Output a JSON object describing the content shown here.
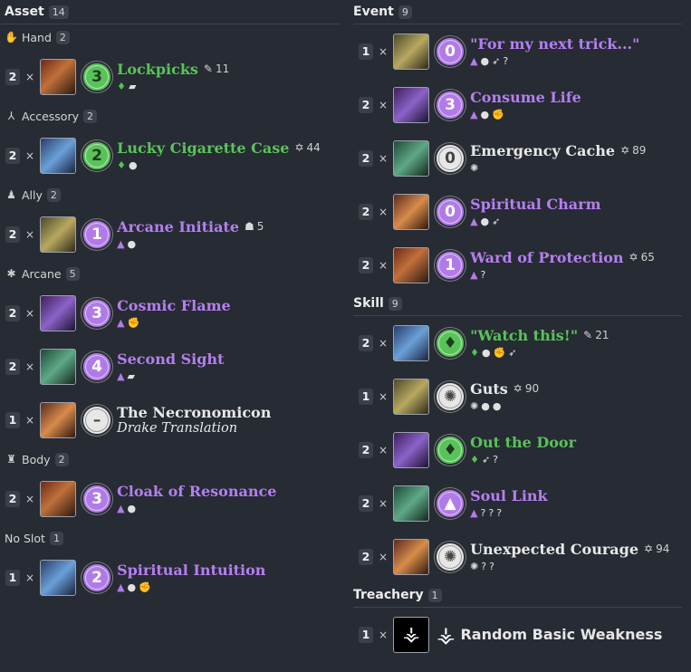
{
  "left": {
    "section": {
      "title": "Asset",
      "count": "14"
    },
    "groups": [
      {
        "slot": "Hand",
        "count": "2",
        "icon": "hand-icon",
        "glyph": "✋",
        "cards": [
          {
            "qty": "2",
            "x": "×",
            "name": "Lockpicks",
            "cost": "3",
            "cls": "seeker",
            "xp": "11",
            "xp_icon": "brain-icon",
            "icons": [
              "seeker-icon",
              "book-icon"
            ]
          }
        ]
      },
      {
        "slot": "Accessory",
        "count": "2",
        "icon": "accessory-icon",
        "glyph": "⅄",
        "cards": [
          {
            "qty": "2",
            "x": "×",
            "name": "Lucky Cigarette Case",
            "cost": "2",
            "cls": "seeker",
            "xp": "44",
            "xp_icon": "elder-sign-icon",
            "icons": [
              "seeker-icon",
              "willpower-icon"
            ]
          }
        ]
      },
      {
        "slot": "Ally",
        "count": "2",
        "icon": "ally-icon",
        "glyph": "♟",
        "cards": [
          {
            "qty": "2",
            "x": "×",
            "name": "Arcane Initiate",
            "cost": "1",
            "cls": "mystic",
            "xp": "5",
            "xp_icon": "cultist-icon",
            "icons": [
              "mystic-icon",
              "willpower-icon"
            ]
          }
        ]
      },
      {
        "slot": "Arcane",
        "count": "5",
        "icon": "arcane-icon",
        "glyph": "✱",
        "cards": [
          {
            "qty": "2",
            "x": "×",
            "name": "Cosmic Flame",
            "cost": "3",
            "cls": "mystic",
            "icons": [
              "mystic-icon",
              "combat-icon"
            ]
          },
          {
            "qty": "2",
            "x": "×",
            "name": "Second Sight",
            "cost": "4",
            "cls": "mystic",
            "icons": [
              "mystic-icon",
              "book-icon"
            ]
          },
          {
            "qty": "1",
            "x": "×",
            "name": "The Necronomicon",
            "subtitle": "Drake Translation",
            "cost": "–",
            "cls": "neutral",
            "icons": []
          }
        ]
      },
      {
        "slot": "Body",
        "count": "2",
        "icon": "body-icon",
        "glyph": "♜",
        "cards": [
          {
            "qty": "2",
            "x": "×",
            "name": "Cloak of Resonance",
            "cost": "3",
            "cls": "mystic",
            "icons": [
              "mystic-icon",
              "willpower-icon"
            ]
          }
        ]
      },
      {
        "slot": "No Slot",
        "count": "1",
        "icon": "",
        "glyph": "",
        "cards": [
          {
            "qty": "1",
            "x": "×",
            "name": "Spiritual Intuition",
            "cost": "2",
            "cls": "mystic",
            "icons": [
              "mystic-icon",
              "willpower-icon",
              "combat-icon"
            ]
          }
        ]
      }
    ]
  },
  "right": {
    "event": {
      "title": "Event",
      "count": "9",
      "cards": [
        {
          "qty": "1",
          "x": "×",
          "name": "\"For my next trick...\"",
          "cost": "0",
          "cls": "mystic",
          "icons": [
            "mystic-icon",
            "willpower-icon",
            "agility-icon",
            "wild-icon"
          ]
        },
        {
          "qty": "2",
          "x": "×",
          "name": "Consume Life",
          "cost": "3",
          "cls": "mystic",
          "icons": [
            "mystic-icon",
            "willpower-icon",
            "combat-icon"
          ]
        },
        {
          "qty": "2",
          "x": "×",
          "name": "Emergency Cache",
          "cost": "0",
          "cls": "neutral",
          "xp": "89",
          "xp_icon": "elder-sign-icon",
          "icons": [
            "neutral-icon"
          ]
        },
        {
          "qty": "2",
          "x": "×",
          "name": "Spiritual Charm",
          "cost": "0",
          "cls": "mystic",
          "icons": [
            "mystic-icon",
            "willpower-icon",
            "agility-icon"
          ]
        },
        {
          "qty": "2",
          "x": "×",
          "name": "Ward of Protection",
          "cost": "1",
          "cls": "mystic",
          "xp": "65",
          "xp_icon": "elder-sign-icon",
          "icons": [
            "mystic-icon",
            "wild-icon"
          ]
        }
      ]
    },
    "skill": {
      "title": "Skill",
      "count": "9",
      "cards": [
        {
          "qty": "2",
          "x": "×",
          "name": "\"Watch this!\"",
          "cost": "",
          "cls": "seeker",
          "xp": "21",
          "xp_icon": "brain-icon",
          "icons": [
            "seeker-icon",
            "willpower-icon",
            "combat-icon",
            "agility-icon"
          ]
        },
        {
          "qty": "1",
          "x": "×",
          "name": "Guts",
          "cost": "",
          "cls": "neutral",
          "xp": "90",
          "xp_icon": "elder-sign-icon",
          "icons": [
            "neutral-icon",
            "willpower-icon",
            "willpower-icon"
          ]
        },
        {
          "qty": "2",
          "x": "×",
          "name": "Out the Door",
          "cost": "",
          "cls": "seeker",
          "icons": [
            "seeker-icon",
            "agility-icon",
            "wild-icon"
          ]
        },
        {
          "qty": "2",
          "x": "×",
          "name": "Soul Link",
          "cost": "",
          "cls": "mystic",
          "icons": [
            "mystic-icon",
            "wild-icon",
            "wild-icon",
            "wild-icon"
          ]
        },
        {
          "qty": "2",
          "x": "×",
          "name": "Unexpected Courage",
          "cost": "",
          "cls": "neutral",
          "xp": "94",
          "xp_icon": "elder-sign-icon",
          "icons": [
            "neutral-icon",
            "wild-icon",
            "wild-icon"
          ]
        }
      ]
    },
    "treachery": {
      "title": "Treachery",
      "count": "1",
      "cards": [
        {
          "qty": "1",
          "x": "×",
          "name": "Random Basic Weakness"
        }
      ]
    }
  },
  "colors": {
    "seeker": "#59c35a",
    "mystic": "#b47ff0",
    "neutral": "#e8e8e8",
    "bg": "#272b33"
  }
}
